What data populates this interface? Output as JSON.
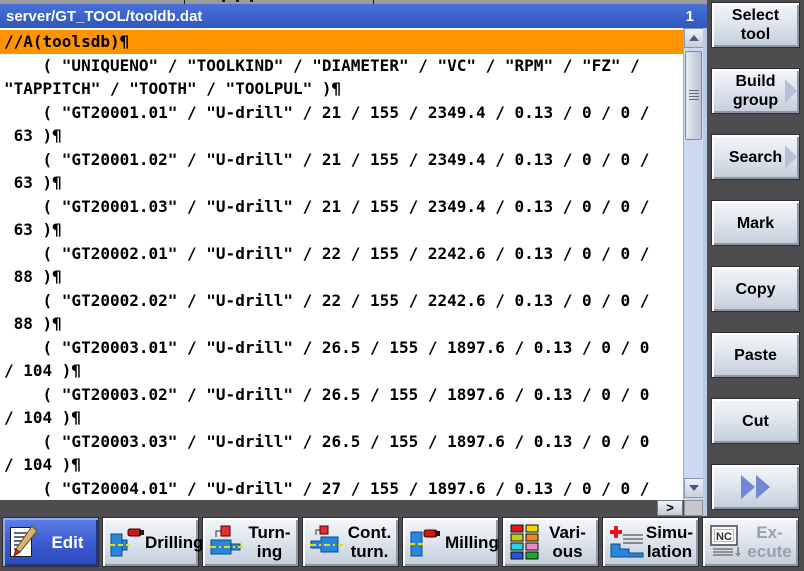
{
  "titlebar": {
    "title": "server/GT_TOOL/tooldb.dat",
    "page": "1"
  },
  "editor": {
    "highlight_index": 0,
    "lines": [
      "//A(toolsdb)¶",
      "    ( \"UNIQUENO\" / \"TOOLKIND\" / \"DIAMETER\" / \"VC\" / \"RPM\" / \"FZ\" /",
      "\"TAPPITCH\" / \"TOOTH\" / \"TOOLPUL\" )¶",
      "    ( \"GT20001.01\" / \"U-drill\" / 21 / 155 / 2349.4 / 0.13 / 0 / 0 /",
      " 63 )¶",
      "    ( \"GT20001.02\" / \"U-drill\" / 21 / 155 / 2349.4 / 0.13 / 0 / 0 /",
      " 63 )¶",
      "    ( \"GT20001.03\" / \"U-drill\" / 21 / 155 / 2349.4 / 0.13 / 0 / 0 /",
      " 63 )¶",
      "    ( \"GT20002.01\" / \"U-drill\" / 22 / 155 / 2242.6 / 0.13 / 0 / 0 /",
      " 88 )¶",
      "    ( \"GT20002.02\" / \"U-drill\" / 22 / 155 / 2242.6 / 0.13 / 0 / 0 /",
      " 88 )¶",
      "    ( \"GT20003.01\" / \"U-drill\" / 26.5 / 155 / 1897.6 / 0.13 / 0 / 0",
      "/ 104 )¶",
      "    ( \"GT20003.02\" / \"U-drill\" / 26.5 / 155 / 1897.6 / 0.13 / 0 / 0",
      "/ 104 )¶",
      "    ( \"GT20003.03\" / \"U-drill\" / 26.5 / 155 / 1897.6 / 0.13 / 0 / 0",
      "/ 104 )¶",
      "    ( \"GT20004.01\" / \"U-drill\" / 27 / 155 / 1897.6 / 0.13 / 0 / 0 /"
    ]
  },
  "scrollbar_h": {
    "arrow_label": ">"
  },
  "softkeys_right": [
    {
      "label": "Select\ntool",
      "arrow": false
    },
    {
      "label": "Build\ngroup",
      "arrow": true
    },
    {
      "label": "Search",
      "arrow": true
    },
    {
      "label": "Mark",
      "arrow": false
    },
    {
      "label": "Copy",
      "arrow": false
    },
    {
      "label": "Paste",
      "arrow": false
    },
    {
      "label": "Cut",
      "arrow": false
    },
    {
      "label": "",
      "icon": "fast-forward"
    }
  ],
  "softkeys_bottom": [
    {
      "label": "Edit",
      "icon": "edit",
      "active": true
    },
    {
      "label": "Drilling",
      "icon": "drilling"
    },
    {
      "label": "Turn-\ning",
      "icon": "turning"
    },
    {
      "label": "Cont.\nturn.",
      "icon": "contour-turning"
    },
    {
      "label": "Milling",
      "icon": "milling"
    },
    {
      "label": "Vari-\nous",
      "icon": "various"
    },
    {
      "label": "Simu-\nlation",
      "icon": "simulation"
    },
    {
      "label": "Ex-\necute",
      "icon": "nc-execute",
      "icon_text": "NC",
      "disabled": true
    }
  ],
  "colors": {
    "titlebar_blue": "#3a61ca",
    "highlight_orange": "#ff9300",
    "panel_dark": "#4d4d4f",
    "active_softkey_blue": "#3c5cd2",
    "scroll_track_blue": "#cdd9f0"
  }
}
